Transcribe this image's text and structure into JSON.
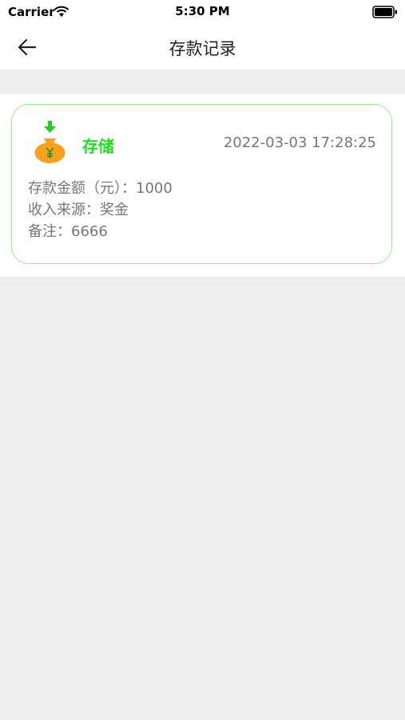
{
  "status_bar": {
    "carrier": "Carrier",
    "time": "5:30 PM"
  },
  "nav": {
    "title": "存款记录",
    "back_icon": "arrow-left-icon"
  },
  "records": [
    {
      "icon": "money-bag-deposit-icon",
      "type_label": "存储",
      "datetime": "2022-03-03 17:28:25",
      "amount_line": "存款金额（元）：1000",
      "source_line": "收入来源：奖金",
      "note_line": "备注：6666"
    }
  ],
  "colors": {
    "accent_green": "#22dd22",
    "card_border": "#99ee88",
    "bag_orange": "#f5a21c",
    "background": "#eeeeee"
  }
}
